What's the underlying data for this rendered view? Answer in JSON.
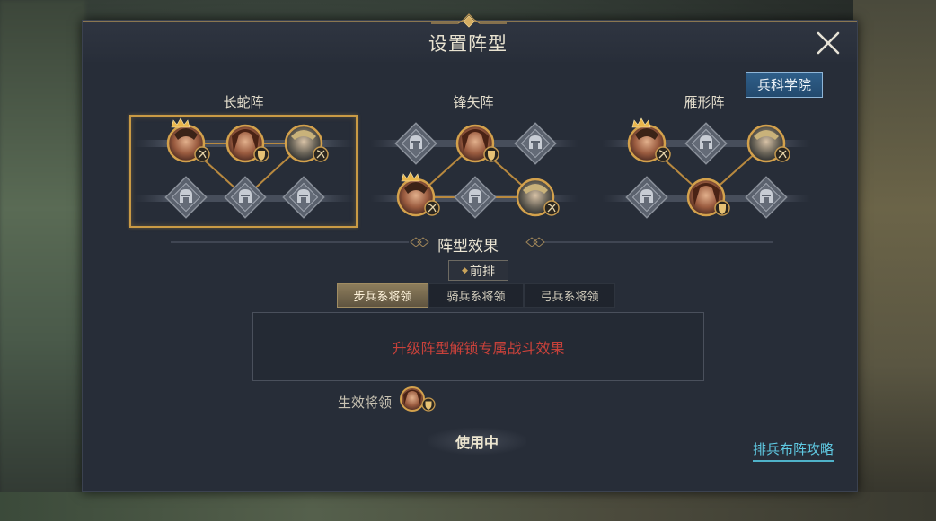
{
  "dialog": {
    "title": "设置阵型",
    "close_icon": "close-icon",
    "academy_button": "兵科学院"
  },
  "formations": [
    {
      "name": "长蛇阵",
      "selected": true
    },
    {
      "name": "锋矢阵",
      "selected": false
    },
    {
      "name": "雁形阵",
      "selected": false
    }
  ],
  "effect": {
    "title": "阵型效果",
    "row_button": "前排",
    "tabs": [
      "步兵系将领",
      "骑兵系将领",
      "弓兵系将领"
    ],
    "active_tab": 0,
    "locked_text": "升级阵型解锁专属战斗效果",
    "active_generals_label": "生效将领"
  },
  "footer": {
    "in_use": "使用中",
    "guide_link": "排兵布阵攻略"
  },
  "colors": {
    "accent_gold": "#c99a45",
    "locked_red": "#c7413a",
    "link_cyan": "#5fc9e2",
    "academy_blue": "#2f5f8a"
  }
}
